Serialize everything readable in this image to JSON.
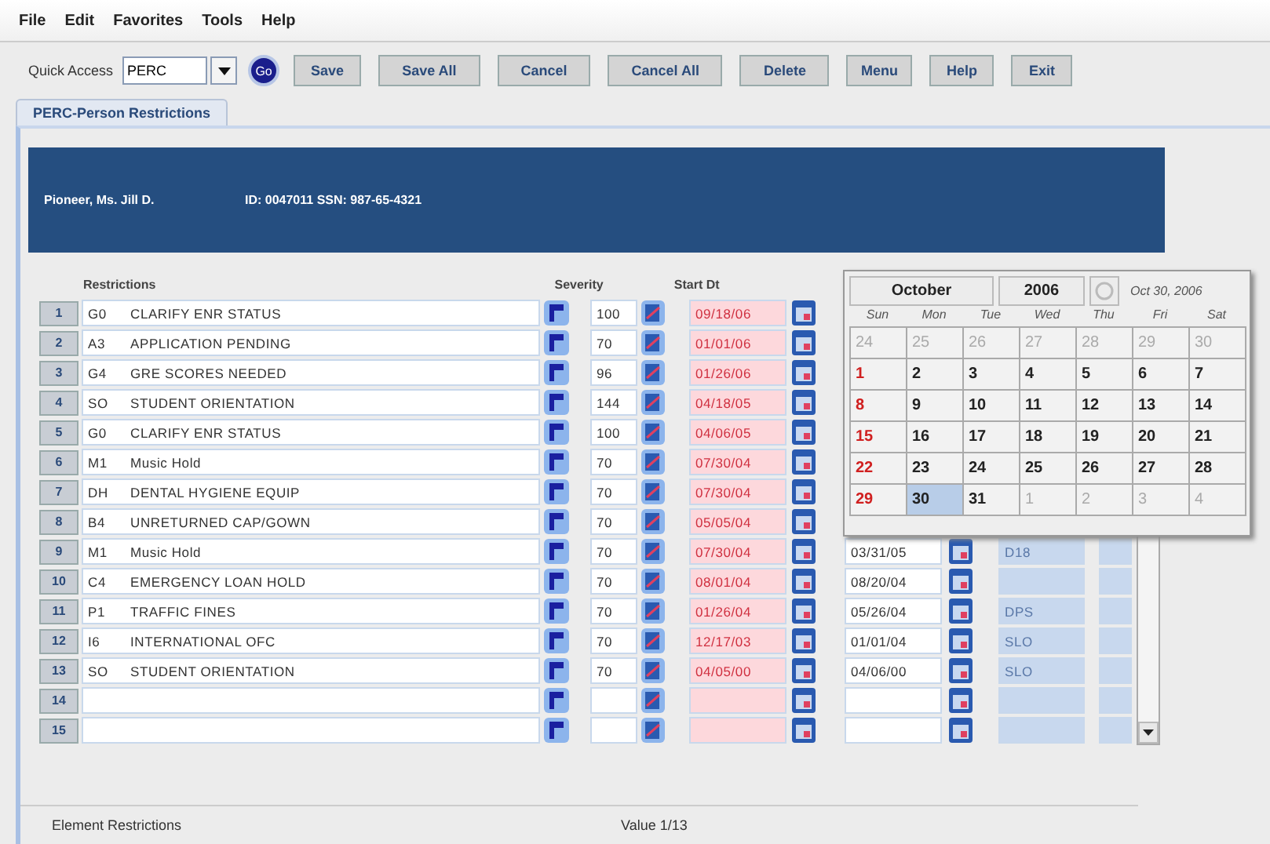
{
  "menu": [
    "File",
    "Edit",
    "Favorites",
    "Tools",
    "Help"
  ],
  "toolbar": {
    "quick_access_label": "Quick Access",
    "quick_access_value": "PERC",
    "go_label": "Go",
    "buttons": [
      "Save",
      "Save All",
      "Cancel",
      "Cancel All",
      "Delete",
      "Menu",
      "Help",
      "Exit"
    ]
  },
  "tabs": [
    {
      "label": "PERC-Person Restrictions",
      "selected": true
    }
  ],
  "banner": {
    "name": "Pioneer, Ms. Jill D.",
    "ids": "ID: 0047011 SSN: 987-65-4321"
  },
  "table": {
    "columns": [
      "Restrictions",
      "Severity",
      "Start Dt"
    ],
    "rows": [
      {
        "number": "1",
        "code": "G0",
        "description": "CLARIFY ENR STATUS",
        "severity": "100",
        "start": "09/18/06"
      },
      {
        "number": "2",
        "code": "A3",
        "description": "APPLICATION PENDING",
        "severity": "70",
        "start": "01/01/06"
      },
      {
        "number": "3",
        "code": "G4",
        "description": "GRE SCORES NEEDED",
        "severity": "96",
        "start": "01/26/06"
      },
      {
        "number": "4",
        "code": "SO",
        "description": "STUDENT ORIENTATION",
        "severity": "144",
        "start": "04/18/05"
      },
      {
        "number": "5",
        "code": "G0",
        "description": "CLARIFY ENR STATUS",
        "severity": "100",
        "start": "04/06/05"
      },
      {
        "number": "6",
        "code": "M1",
        "description": "Music Hold",
        "severity": "70",
        "start": "07/30/04"
      },
      {
        "number": "7",
        "code": "DH",
        "description": "DENTAL HYGIENE EQUIP",
        "severity": "70",
        "start": "07/30/04"
      },
      {
        "number": "8",
        "code": "B4",
        "description": "UNRETURNED CAP/GOWN",
        "severity": "70",
        "start": "05/05/04"
      },
      {
        "number": "9",
        "code": "M1",
        "description": "Music Hold",
        "severity": "70",
        "start": "07/30/04",
        "end": "03/31/05",
        "column_4": "D18"
      },
      {
        "number": "10",
        "code": "C4",
        "description": "EMERGENCY LOAN HOLD",
        "severity": "70",
        "start": "08/01/04",
        "end": "08/20/04"
      },
      {
        "number": "11",
        "code": "P1",
        "description": "TRAFFIC FINES",
        "severity": "70",
        "start": "01/26/04",
        "end": "05/26/04",
        "column_4": "DPS"
      },
      {
        "number": "12",
        "code": "I6",
        "description": "INTERNATIONAL OFC",
        "severity": "70",
        "start": "12/17/03",
        "end": "01/01/04",
        "column_4": "SLO"
      },
      {
        "number": "13",
        "code": "SO",
        "description": "STUDENT ORIENTATION",
        "severity": "70",
        "start": "04/05/00",
        "end": "04/06/00",
        "column_4": "SLO"
      },
      {
        "number": "14"
      },
      {
        "number": "15"
      }
    ]
  },
  "calendar": {
    "month": "October",
    "year": "2006",
    "today": "Oct 30, 2006",
    "weekdays": [
      "Sun",
      "Mon",
      "Tue",
      "Wed",
      "Thu",
      "Fri",
      "Sat"
    ],
    "days": [
      {
        "label": "24",
        "in_month": false,
        "selected": false
      },
      {
        "label": "25",
        "in_month": false,
        "selected": false
      },
      {
        "label": "26",
        "in_month": false,
        "selected": false
      },
      {
        "label": "27",
        "in_month": false,
        "selected": false
      },
      {
        "label": "28",
        "in_month": false,
        "selected": false
      },
      {
        "label": "29",
        "in_month": false,
        "selected": false
      },
      {
        "label": "30",
        "in_month": false,
        "selected": false
      },
      {
        "label": "1",
        "in_month": true,
        "selected": false
      },
      {
        "label": "2",
        "in_month": true,
        "selected": false
      },
      {
        "label": "3",
        "in_month": true,
        "selected": false
      },
      {
        "label": "4",
        "in_month": true,
        "selected": false
      },
      {
        "label": "5",
        "in_month": true,
        "selected": false
      },
      {
        "label": "6",
        "in_month": true,
        "selected": false
      },
      {
        "label": "7",
        "in_month": true,
        "selected": false
      },
      {
        "label": "8",
        "in_month": true,
        "selected": false
      },
      {
        "label": "9",
        "in_month": true,
        "selected": false
      },
      {
        "label": "10",
        "in_month": true,
        "selected": false
      },
      {
        "label": "11",
        "in_month": true,
        "selected": false
      },
      {
        "label": "12",
        "in_month": true,
        "selected": false
      },
      {
        "label": "13",
        "in_month": true,
        "selected": false
      },
      {
        "label": "14",
        "in_month": true,
        "selected": false
      },
      {
        "label": "15",
        "in_month": true,
        "selected": false
      },
      {
        "label": "16",
        "in_month": true,
        "selected": false
      },
      {
        "label": "17",
        "in_month": true,
        "selected": false
      },
      {
        "label": "18",
        "in_month": true,
        "selected": false
      },
      {
        "label": "19",
        "in_month": true,
        "selected": false
      },
      {
        "label": "20",
        "in_month": true,
        "selected": false
      },
      {
        "label": "21",
        "in_month": true,
        "selected": false
      },
      {
        "label": "22",
        "in_month": true,
        "selected": false
      },
      {
        "label": "23",
        "in_month": true,
        "selected": false
      },
      {
        "label": "24",
        "in_month": true,
        "selected": false
      },
      {
        "label": "25",
        "in_month": true,
        "selected": false
      },
      {
        "label": "26",
        "in_month": true,
        "selected": false
      },
      {
        "label": "27",
        "in_month": true,
        "selected": false
      },
      {
        "label": "28",
        "in_month": true,
        "selected": false
      },
      {
        "label": "29",
        "in_month": true,
        "selected": false
      },
      {
        "label": "30",
        "in_month": true,
        "selected": true
      },
      {
        "label": "31",
        "in_month": true,
        "selected": false
      },
      {
        "label": "1",
        "in_month": false,
        "selected": false
      },
      {
        "label": "2",
        "in_month": false,
        "selected": false
      },
      {
        "label": "3",
        "in_month": false,
        "selected": false
      },
      {
        "label": "4",
        "in_month": false,
        "selected": false
      }
    ]
  },
  "status_bar": {
    "left": "Element Restrictions",
    "right": "Value 1/13"
  }
}
